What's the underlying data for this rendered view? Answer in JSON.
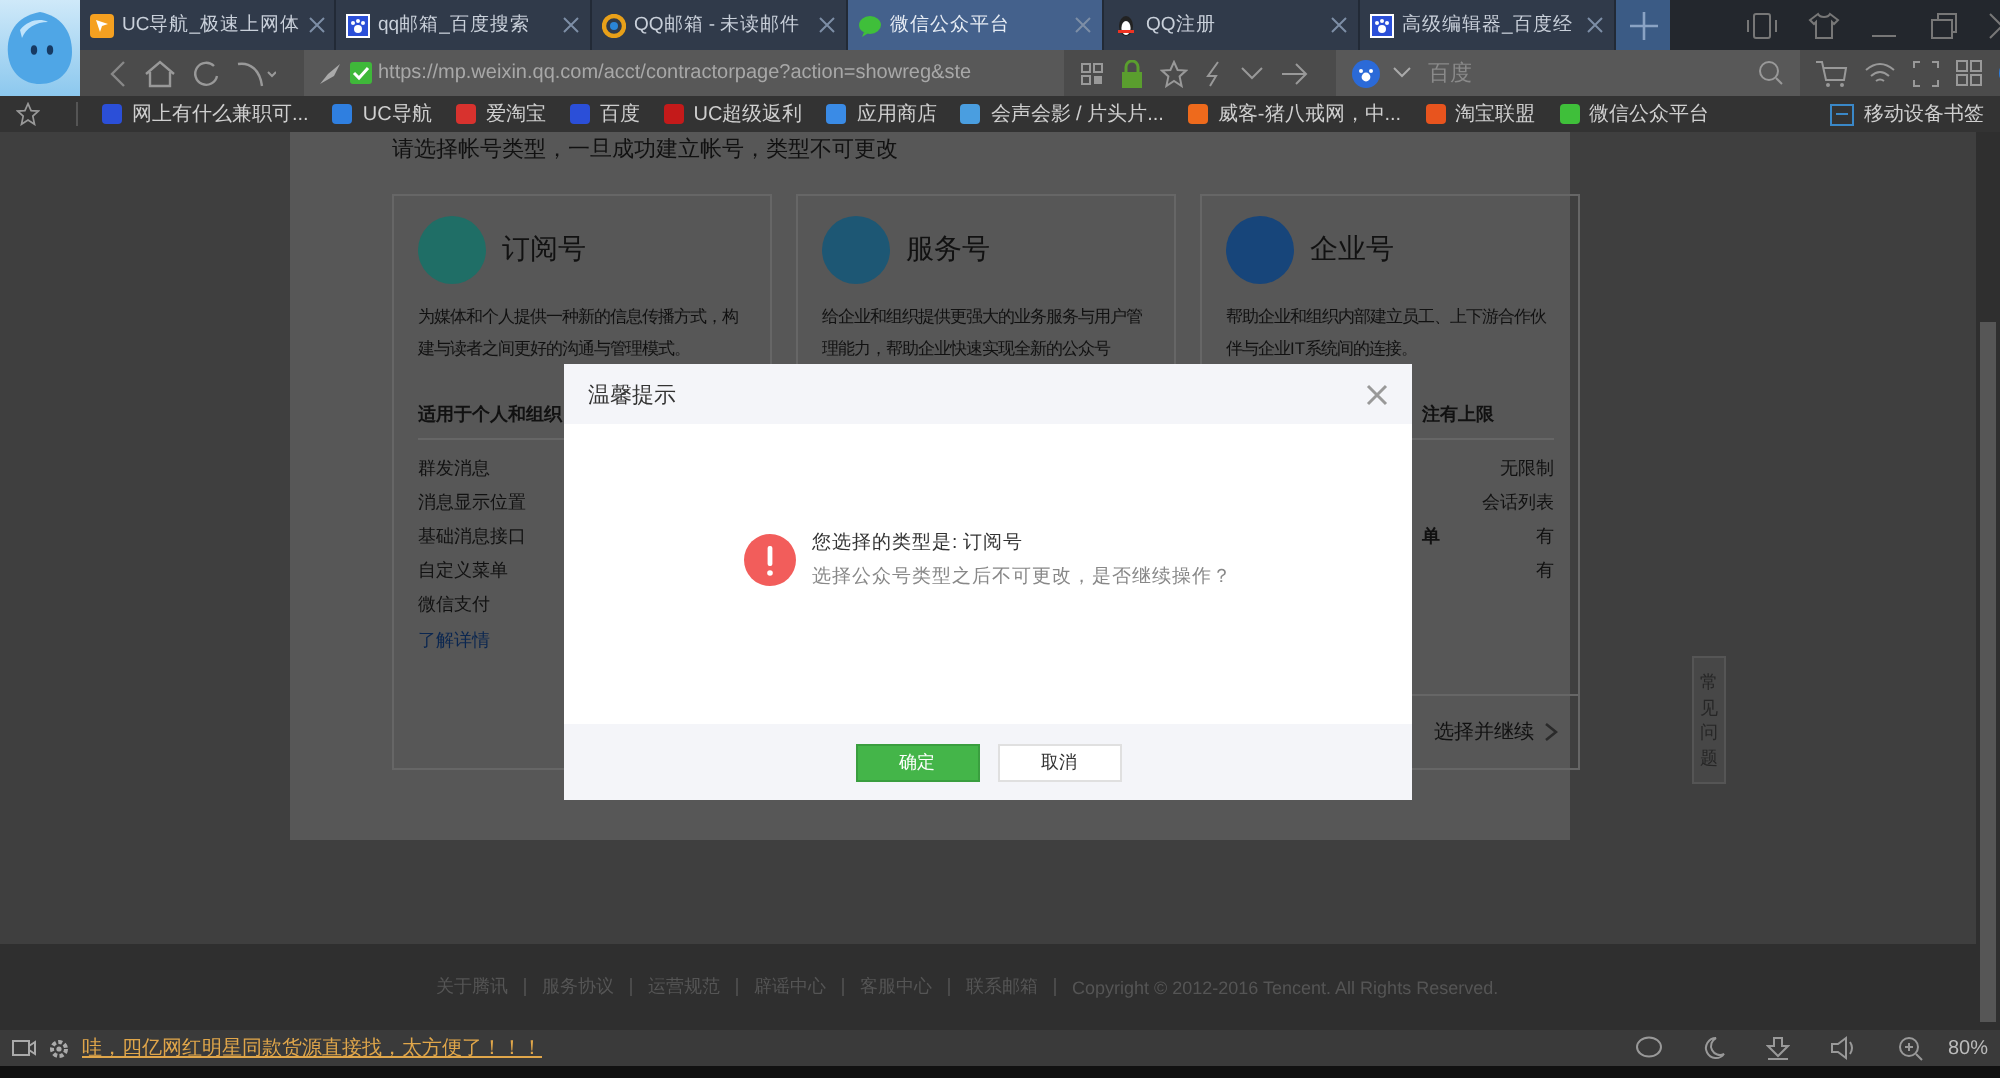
{
  "tabs": [
    {
      "title": "UC导航_极速上网体",
      "kind": "uc",
      "selected": false
    },
    {
      "title": "qq邮箱_百度搜索",
      "kind": "paw",
      "selected": false
    },
    {
      "title": "QQ邮箱 - 未读邮件",
      "kind": "ring",
      "selected": false
    },
    {
      "title": "微信公众平台",
      "kind": "chat",
      "selected": true
    },
    {
      "title": "QQ注册",
      "kind": "penguin",
      "selected": false
    },
    {
      "title": "高级编辑器_百度经",
      "kind": "paw",
      "selected": false
    }
  ],
  "address": {
    "value": "https://mp.weixin.qq.com/acct/contractorpage?action=showreg&ste"
  },
  "search": {
    "placeholder": "百度"
  },
  "bookmarks": [
    {
      "label": "网上有什么兼职可...",
      "color": "#2b4fd8"
    },
    {
      "label": "UC导航",
      "color": "#2f7fe0"
    },
    {
      "label": "爱淘宝",
      "color": "#d8322e"
    },
    {
      "label": "百度",
      "color": "#2b4fd8"
    },
    {
      "label": "UC超级返利",
      "color": "#c41a1a"
    },
    {
      "label": "应用商店",
      "color": "#3a8be6"
    },
    {
      "label": "会声会影 / 片头片...",
      "color": "#4a9ee0"
    },
    {
      "label": "威客-猪八戒网，中...",
      "color": "#ee6a1c"
    },
    {
      "label": "淘宝联盟",
      "color": "#e8541e"
    },
    {
      "label": "微信公众平台",
      "color": "#3fbf3a"
    }
  ],
  "mobile_bookmarks": "移动设备书签",
  "page": {
    "intro": "请选择帐号类型，一旦成功建立帐号，类型不可更改",
    "cards": [
      {
        "title": "订阅号",
        "color": "#1f6e66",
        "description": "为媒体和个人提供一种新的信息传播方式，构建与读者之间更好的沟通与管理模式。",
        "subtitle": "适用于个人和组织",
        "features": [
          {
            "label": "群发消息"
          },
          {
            "label": "消息显示位置"
          },
          {
            "label": "基础消息接口"
          },
          {
            "label": "自定义菜单"
          },
          {
            "label": "微信支付"
          }
        ],
        "link": "了解详情"
      },
      {
        "title": "服务号",
        "color": "#1d5774",
        "description": "给企业和组织提供更强大的业务服务与用户管理能力，帮助企业快速实现全新的公众号"
      },
      {
        "title": "企业号",
        "color": "#17457a",
        "description": "帮助企业和组织内部建立员工、上下游合作伙伴与企业IT系统间的连接。",
        "subtitle": "注有上限",
        "features": [
          {
            "value": "无限制"
          },
          {
            "value": "会话列表"
          },
          {
            "label": "单",
            "value": "有"
          },
          {
            "value": "有"
          }
        ],
        "action": "选择并继续"
      }
    ],
    "side_tab": "常见问题",
    "footer": {
      "links": [
        "关于腾讯",
        "服务协议",
        "运营规范",
        "辟谣中心",
        "客服中心",
        "联系邮箱"
      ],
      "copyright": "Copyright © 2012-2016 Tencent. All Rights Reserved."
    }
  },
  "dialog": {
    "title": "温馨提示",
    "heading": "您选择的类型是: 订阅号",
    "message": "选择公众号类型之后不可更改，是否继续操作？",
    "buttons": [
      {
        "label": "确定",
        "kind": "primary"
      },
      {
        "label": "取消",
        "kind": "default"
      }
    ]
  },
  "status_bar": {
    "ad": "哇，四亿网红明星同款货源直接找，太方便了！！！",
    "zoom": "80%"
  }
}
